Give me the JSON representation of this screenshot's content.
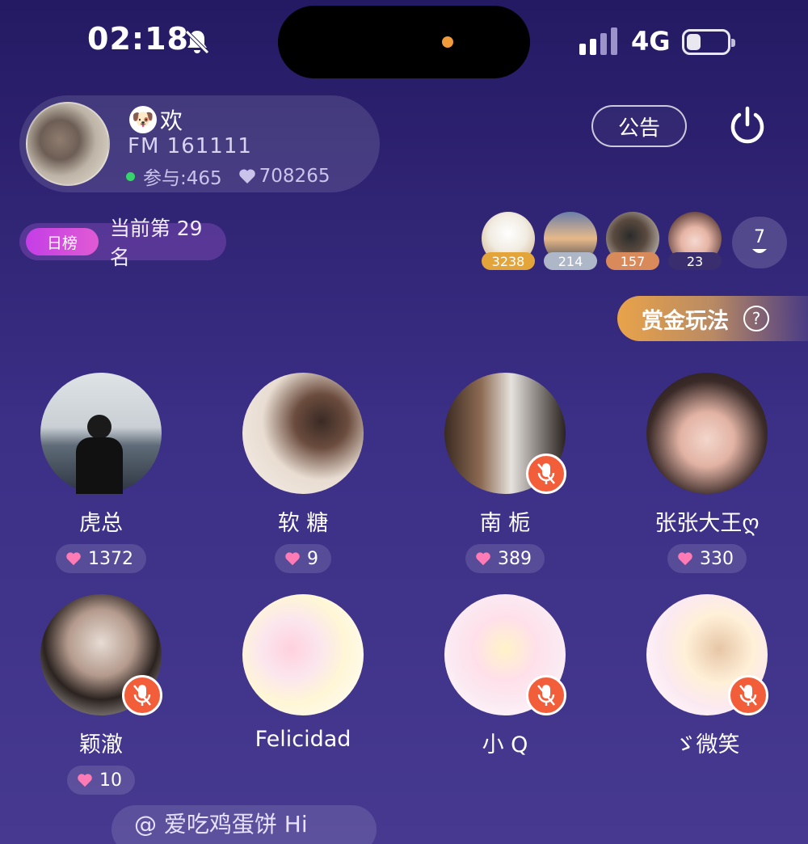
{
  "status_bar": {
    "time": "02:18",
    "network": "4G"
  },
  "room": {
    "title": "欢",
    "fm_id": "FM 161111",
    "participants_label": "参与:465",
    "likes": "708265",
    "notice_label": "公告"
  },
  "rank": {
    "tag": "日榜",
    "text": "当前第 29 名"
  },
  "contributors": [
    {
      "score": "3238",
      "badge_color": "#e3a43a"
    },
    {
      "score": "214",
      "badge_color": "#aeb7c8"
    },
    {
      "score": "157",
      "badge_color": "#d98a5a"
    },
    {
      "score": "23",
      "badge_color": "#3a2e6e"
    }
  ],
  "more_count": "7",
  "bounty": {
    "label": "赏金玩法",
    "help": "?"
  },
  "seats": [
    {
      "name": "虎总",
      "hearts": "1372",
      "muted": false
    },
    {
      "name": "软 糖",
      "hearts": "9",
      "muted": false
    },
    {
      "name": "南 栀",
      "hearts": "389",
      "muted": true
    },
    {
      "name": "张张大王ღ",
      "hearts": "330",
      "muted": false
    },
    {
      "name": "颖澈",
      "hearts": "10",
      "muted": true
    },
    {
      "name": "Felicidad",
      "hearts": "",
      "muted": false
    },
    {
      "name": "小 Q",
      "hearts": "",
      "muted": true
    },
    {
      "name": "ゞ微笑",
      "hearts": "",
      "muted": true
    }
  ],
  "bottom_text": "@ 爱吃鸡蛋饼 Hi",
  "colors": {
    "mute_red": "#f25d3a",
    "heart_pink": "#ff7bb5",
    "bounty_gold": "#e9a34a"
  }
}
